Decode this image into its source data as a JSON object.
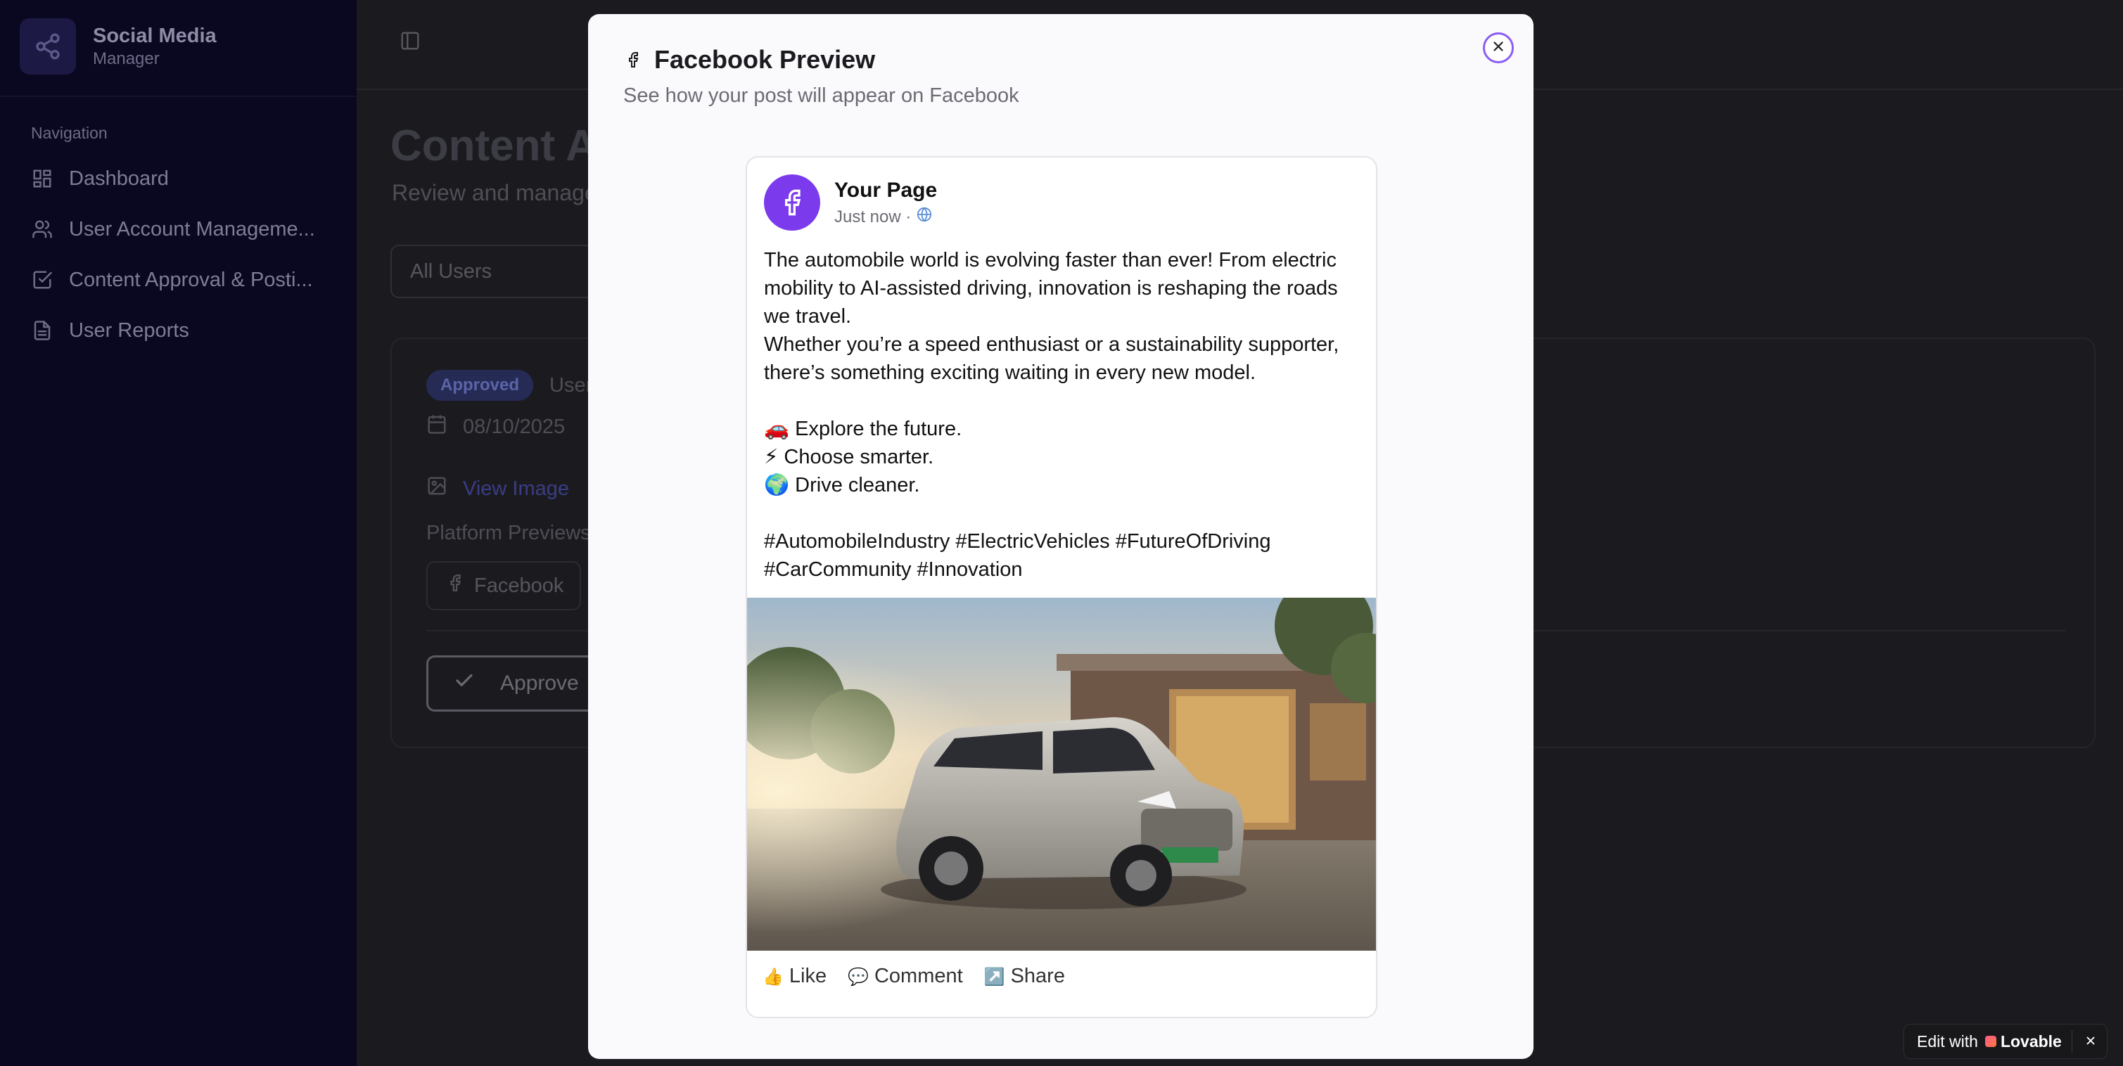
{
  "sidebar": {
    "brand_title": "Social Media",
    "brand_subtitle": "Manager",
    "nav_heading": "Navigation",
    "items": [
      {
        "label": "Dashboard",
        "icon": "dashboard-icon"
      },
      {
        "label": "User Account Manageme...",
        "icon": "users-icon"
      },
      {
        "label": "Content Approval & Posti...",
        "icon": "check-square-icon"
      },
      {
        "label": "User Reports",
        "icon": "report-icon"
      }
    ]
  },
  "main": {
    "page_title": "Content A",
    "page_subtitle": "Review and manage",
    "filter_value": "All Users",
    "card": {
      "status_badge": "Approved",
      "user_text": "User",
      "date": "08/10/2025",
      "view_image": "View Image",
      "platform_previews_label": "Platform Previews:",
      "facebook_chip": "Facebook",
      "approve_button": "Approve"
    }
  },
  "modal": {
    "title": "Facebook Preview",
    "subtitle": "See how your post will appear on Facebook",
    "post": {
      "page_name": "Your Page",
      "time": "Just now ·",
      "body": "The automobile world is evolving faster than ever! From electric mobility to AI-assisted driving, innovation is reshaping the roads we travel.\nWhether you’re a speed enthusiast or a sustainability supporter, there’s something exciting waiting in every new model.\n\n🚗 Explore the future.\n⚡ Choose smarter.\n🌍 Drive cleaner.\n\n#AutomobileIndustry #ElectricVehicles #FutureOfDriving #CarCommunity #Innovation",
      "actions": [
        {
          "emoji": "👍",
          "label": "Like"
        },
        {
          "emoji": "💬",
          "label": "Comment"
        },
        {
          "emoji": "↗️",
          "label": "Share"
        }
      ]
    }
  },
  "lovable": {
    "prefix": "Edit with",
    "brand": "Lovable"
  },
  "colors": {
    "accent": "#7c3aed",
    "sidebar_bg": "#0a0720",
    "overlay_bg": "#1b1b1f"
  }
}
